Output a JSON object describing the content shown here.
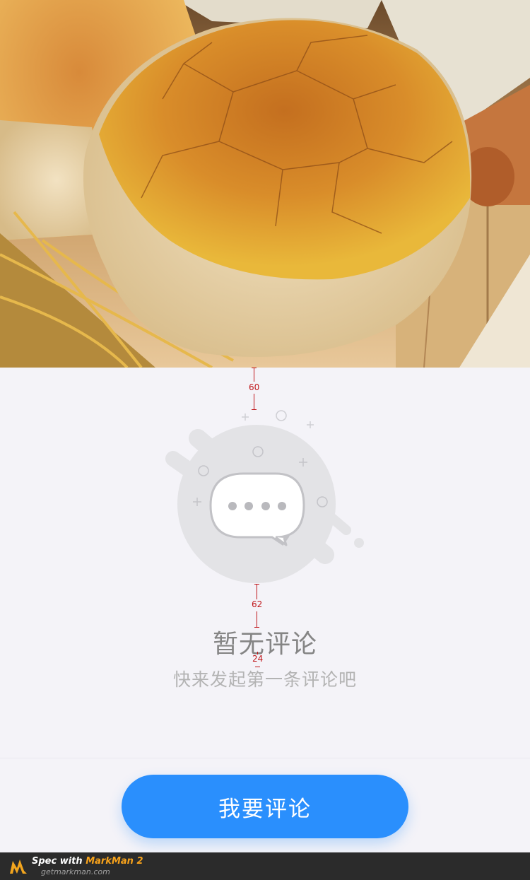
{
  "hero": {
    "image_name": "bread-loaf-photo"
  },
  "empty_state": {
    "title": "暂无评论",
    "subtitle": "快来发起第一条评论吧",
    "icon_name": "chat-bubble-icon"
  },
  "spec_annotations": {
    "top_gap": "60",
    "icon_title_gap": "62",
    "title_subtitle_gap": "24"
  },
  "action": {
    "comment_button_label": "我要评论"
  },
  "footer": {
    "spec_with": "Spec with ",
    "brand": "MarkMan 2",
    "site": "getmarkman.com"
  },
  "colors": {
    "background": "#f4f3f8",
    "button": "#2a8ffd",
    "title_text": "#858585",
    "subtitle_text": "#b3b3b3",
    "annotation": "#c0171b"
  }
}
